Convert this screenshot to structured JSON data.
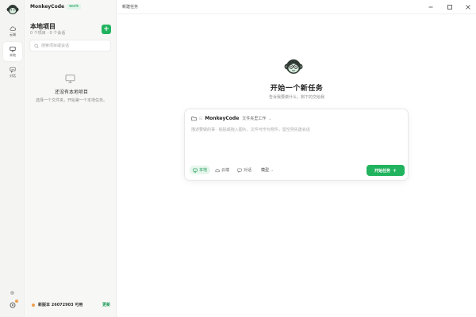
{
  "rail": {
    "items": [
      {
        "label": "云端",
        "icon": "cloud-icon"
      },
      {
        "label": "本地",
        "icon": "monitor-icon",
        "active": true
      },
      {
        "label": "对话",
        "icon": "chat-icon"
      }
    ]
  },
  "sidebar": {
    "brand": "MonkeyCode",
    "badge": "work",
    "title": "本地项目",
    "subtitle": "0 个项目 · 0 个会话",
    "add_label": "+",
    "search_placeholder": "搜索项目或会话",
    "empty_title": "还没有本地项目",
    "empty_desc": "选择一个文件夹，开始第一个本地任务。",
    "update_text": "新版本 26072903 可用",
    "update_link": "更新"
  },
  "titlebar": {
    "title": "新建任务"
  },
  "main": {
    "title": "开始一个新任务",
    "subtitle": "告诉我要做什么，剩下的交给我"
  },
  "card": {
    "project_name": "MonkeyCode",
    "branch": "文件夹里工作",
    "caret": "⌄",
    "placeholder": "描述要做的事 · 粘贴或拖入图片、文件可作为附件，留空则先建会话",
    "modes": [
      {
        "label": "本地",
        "active": true
      },
      {
        "label": "云端",
        "active": false
      },
      {
        "label": "对话",
        "active": false
      }
    ],
    "model_label": "模型",
    "model_caret": "⌄",
    "start_label": "开始任务"
  },
  "colors": {
    "accent": "#21b35e",
    "accent_text": "#1a9a54",
    "badge_bg": "#e2f5ea",
    "update_dot": "#f0a050"
  }
}
